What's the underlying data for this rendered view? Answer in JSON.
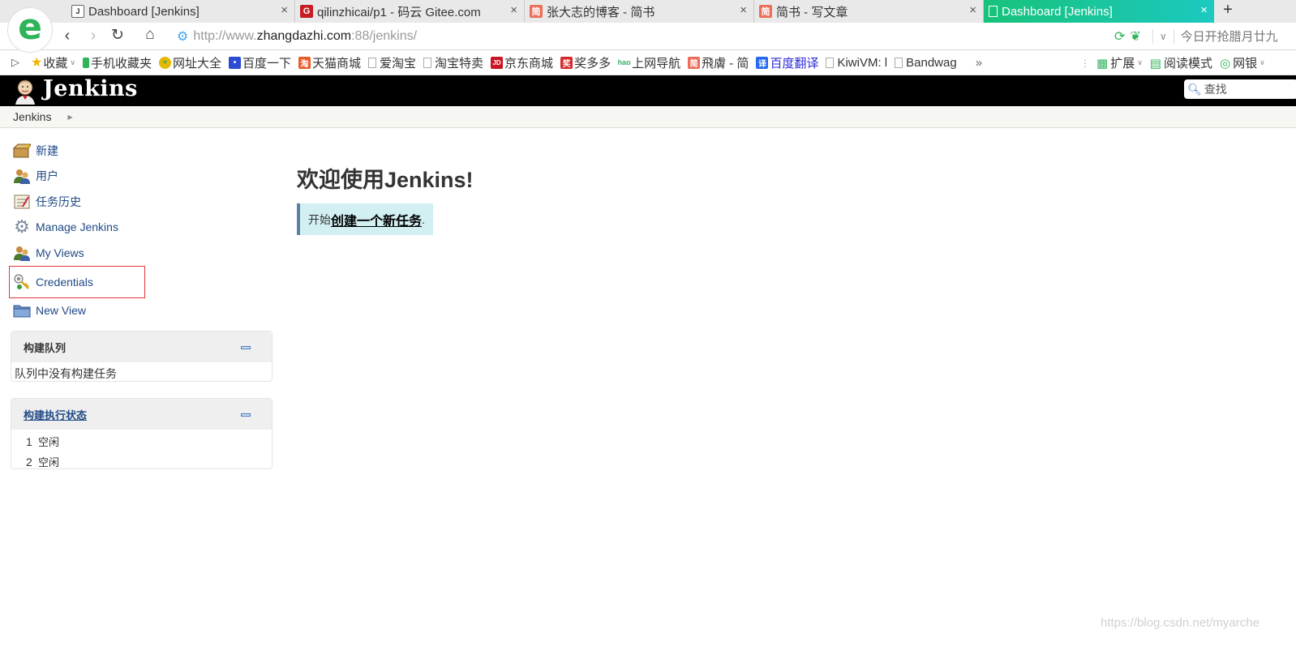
{
  "browser": {
    "tabs": [
      {
        "title": "Dashboard [Jenkins]",
        "favicon": "jenkins-favicon",
        "active": false
      },
      {
        "title": "qilinzhicai/p1 - 码云 Gitee.com",
        "favicon": "gitee-favicon",
        "active": false
      },
      {
        "title": "张大志的博客 - 简书",
        "favicon": "jianshu-favicon",
        "favicon_text": "简",
        "active": false
      },
      {
        "title": "简书 - 写文章",
        "favicon": "jianshu-favicon",
        "favicon_text": "简",
        "active": false
      },
      {
        "title": "Dashboard [Jenkins]",
        "favicon": "page-favicon",
        "active": true
      }
    ],
    "new_tab": "+",
    "tab_close": "×",
    "url": {
      "prefix": "http://www.",
      "host": "zhangdazhi.com",
      "suffix": ":88/jenkins/"
    },
    "address_right_text": "今日开抢腊月廿九",
    "bookmarks": [
      {
        "label": "收藏",
        "icon": "star-icon"
      },
      {
        "label": "手机收藏夹",
        "icon": "phone-icon"
      },
      {
        "label": "网址大全",
        "icon": "web-icon"
      },
      {
        "label": "百度一下",
        "icon": "baidu-icon"
      },
      {
        "label": "天猫商城",
        "icon": "tmall-icon"
      },
      {
        "label": "爱淘宝",
        "icon": "page-icon"
      },
      {
        "label": "淘宝特卖",
        "icon": "page-icon"
      },
      {
        "label": "京东商城",
        "icon": "jd-icon"
      },
      {
        "label": "奖多多",
        "icon": "jiang-icon"
      },
      {
        "label": "上网导航",
        "icon": "hao-icon"
      },
      {
        "label": "飛膚 - 简",
        "icon": "jianshu-icon"
      },
      {
        "label": "百度翻译",
        "icon": "translate-icon"
      },
      {
        "label": "KiwiVM: l",
        "icon": "page-icon"
      },
      {
        "label": "Bandwag",
        "icon": "page-icon"
      }
    ],
    "bookmarks_more": "»",
    "bookmarks_right": [
      {
        "label": "扩展",
        "icon": "extension-icon"
      },
      {
        "label": "阅读模式",
        "icon": "read-mode-icon"
      },
      {
        "label": "网银",
        "icon": "bank-icon"
      }
    ]
  },
  "jenkins": {
    "title": "Jenkins",
    "search_placeholder": "查找",
    "breadcrumb": "Jenkins",
    "tasks": [
      {
        "label": "新建",
        "icon": "new-item-icon"
      },
      {
        "label": "用户",
        "icon": "people-icon"
      },
      {
        "label": "任务历史",
        "icon": "build-history-icon"
      },
      {
        "label": "Manage Jenkins",
        "icon": "manage-gear-icon"
      },
      {
        "label": "My Views",
        "icon": "my-views-icon"
      },
      {
        "label": "Credentials",
        "icon": "credentials-icon"
      },
      {
        "label": "New View",
        "icon": "new-view-folder-icon"
      }
    ],
    "build_queue": {
      "title": "构建队列",
      "empty_text": "队列中没有构建任务"
    },
    "executors": {
      "title": "构建执行状态",
      "rows": [
        {
          "num": "1",
          "status": "空闲"
        },
        {
          "num": "2",
          "status": "空闲"
        }
      ]
    },
    "welcome_title": "欢迎使用Jenkins!",
    "cta_prefix": "开始",
    "cta_link": "创建一个新任务",
    "cta_suffix": "."
  },
  "watermark": "https://blog.csdn.net/myarche"
}
